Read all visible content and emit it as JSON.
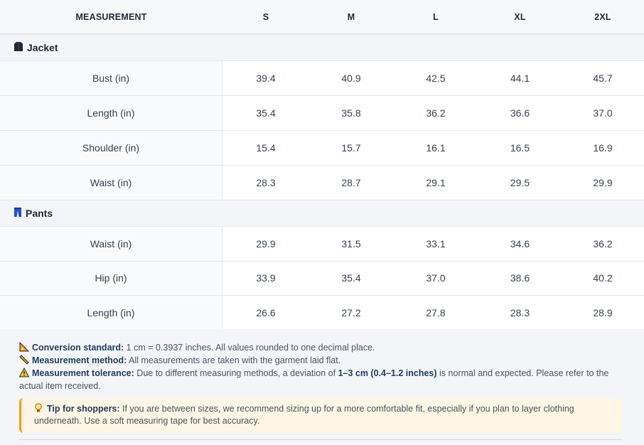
{
  "header": {
    "measurement": "MEASUREMENT",
    "sizes": [
      "S",
      "M",
      "L",
      "XL",
      "2XL"
    ]
  },
  "sections": [
    {
      "title": "Jacket",
      "icon": "jacket-icon",
      "rows": [
        {
          "label": "Bust (in)",
          "values": [
            "39.4",
            "40.9",
            "42.5",
            "44.1",
            "45.7"
          ]
        },
        {
          "label": "Length (in)",
          "values": [
            "35.4",
            "35.8",
            "36.2",
            "36.6",
            "37.0"
          ]
        },
        {
          "label": "Shoulder (in)",
          "values": [
            "15.4",
            "15.7",
            "16.1",
            "16.5",
            "16.9"
          ]
        },
        {
          "label": "Waist (in)",
          "values": [
            "28.3",
            "28.7",
            "29.1",
            "29.5",
            "29.9"
          ]
        }
      ]
    },
    {
      "title": "Pants",
      "icon": "pants-icon",
      "rows": [
        {
          "label": "Waist (in)",
          "values": [
            "29.9",
            "31.5",
            "33.1",
            "34.6",
            "36.2"
          ]
        },
        {
          "label": "Hip (in)",
          "values": [
            "33.9",
            "35.4",
            "37.0",
            "38.6",
            "40.2"
          ]
        },
        {
          "label": "Length (in)",
          "values": [
            "26.6",
            "27.2",
            "27.8",
            "28.3",
            "28.9"
          ]
        }
      ]
    }
  ],
  "notes": {
    "conversion": {
      "icon": "triangle-ruler-icon",
      "label": "Conversion standard:",
      "text": " 1 cm = 0.3937 inches. All values rounded to one decimal place."
    },
    "method": {
      "icon": "ruler-icon",
      "label": "Measurement method:",
      "text": " All measurements are taken with the garment laid flat."
    },
    "tolerance": {
      "icon": "warning-icon",
      "label": "Measurement tolerance:",
      "text_before": " Due to different measuring methods, a deviation of ",
      "highlight": "1–3 cm (0.4–1.2 inches)",
      "text_after": " is normal and expected. Please refer to the actual item received."
    }
  },
  "tip": {
    "icon": "lightbulb-icon",
    "label": "Tip for shoppers:",
    "text": " If you are between sizes, we recommend sizing up for a more comfortable fit, especially if you plan to layer clothing underneath. Use a soft measuring tape for best accuracy."
  },
  "colors": {
    "accent": "#1e3a5f",
    "tip_border": "#f59e0b",
    "tip_bg": "#fef5e4",
    "pants_icon": "#1d4ed8"
  }
}
